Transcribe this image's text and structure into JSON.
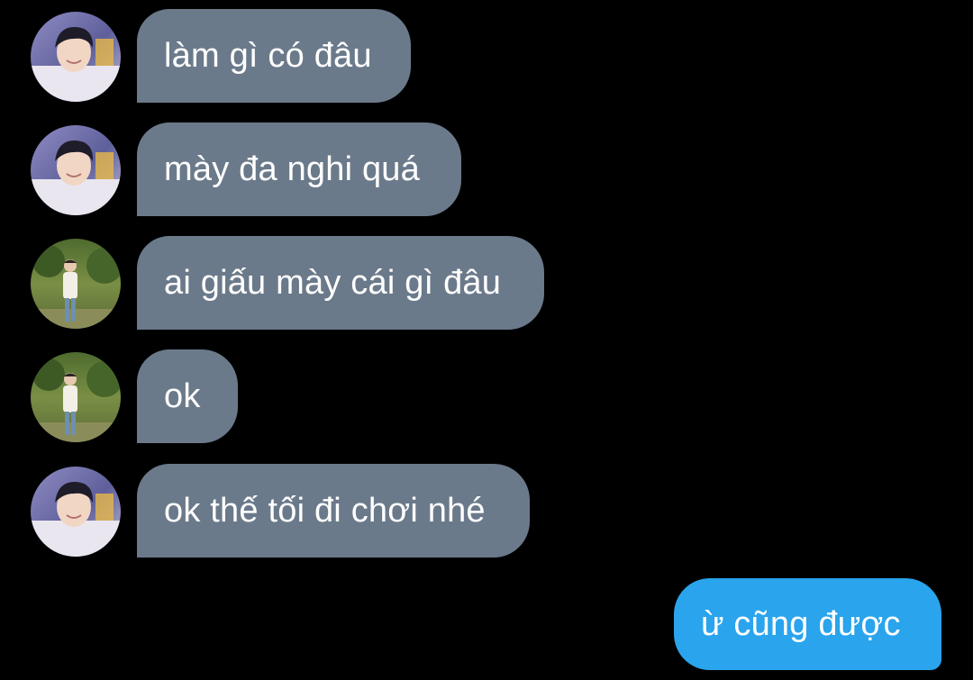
{
  "conversation": {
    "messages": [
      {
        "sender": "contact",
        "avatar": "portrait-indoor-avatar",
        "text": "làm gì có đâu"
      },
      {
        "sender": "contact",
        "avatar": "portrait-indoor-avatar",
        "text": "mày đa nghi quá"
      },
      {
        "sender": "contact",
        "avatar": "portrait-outdoor-avatar",
        "text": "ai giấu mày cái gì đâu"
      },
      {
        "sender": "contact",
        "avatar": "portrait-outdoor-avatar",
        "text": "ok"
      },
      {
        "sender": "contact",
        "avatar": "portrait-indoor-avatar",
        "text": "ok thế tối đi chơi nhé"
      },
      {
        "sender": "me",
        "text": "ừ cũng được"
      }
    ]
  },
  "colors": {
    "background": "#000000",
    "incoming_bubble": "#6b7a8a",
    "outgoing_bubble": "#2aa4ec",
    "text": "#ffffff"
  }
}
